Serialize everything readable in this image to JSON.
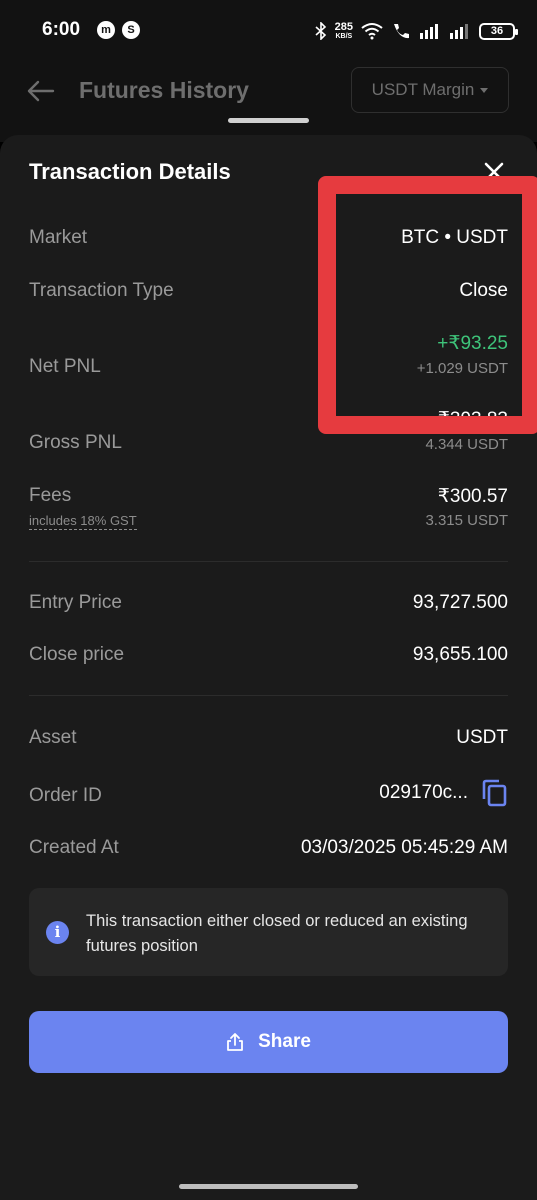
{
  "status_bar": {
    "time": "6:00",
    "net_speed_value": "285",
    "net_speed_unit": "KB/S",
    "battery": "36",
    "icons": [
      "coinmarket-icon",
      "s-app-icon",
      "bluetooth-icon",
      "wifi-icon",
      "call-icon",
      "signal-icon",
      "signal-icon",
      "battery-icon"
    ]
  },
  "header": {
    "title": "Futures History",
    "margin_selector": "USDT Margin"
  },
  "sheet": {
    "title": "Transaction Details",
    "rows": {
      "market": {
        "label": "Market",
        "value": "BTC • USDT"
      },
      "transaction_type": {
        "label": "Transaction Type",
        "value": "Close"
      },
      "net_pnl": {
        "label": "Net PNL",
        "value": "+₹93.25",
        "subvalue": "+1.029 USDT"
      },
      "gross_pnl": {
        "label": "Gross PNL",
        "value": "₹393.83",
        "subvalue": "4.344 USDT"
      },
      "fees": {
        "label": "Fees",
        "note": "includes 18% GST",
        "value": "₹300.57",
        "subvalue": "3.315 USDT"
      },
      "entry_price": {
        "label": "Entry Price",
        "value": "93,727.500"
      },
      "close_price": {
        "label": "Close price",
        "value": "93,655.100"
      },
      "asset": {
        "label": "Asset",
        "value": "USDT"
      },
      "order_id": {
        "label": "Order ID",
        "value": "029170c..."
      },
      "created_at": {
        "label": "Created At",
        "value": "03/03/2025 05:45:29 AM"
      }
    },
    "info": {
      "icon": "i",
      "text": "This transaction either closed or reduced an existing futures position"
    },
    "share_label": "Share"
  },
  "colors": {
    "accent": "#6b84f0",
    "positive": "#3ec47a",
    "highlight": "#e63b3f",
    "sheet_bg": "#1b1b1b"
  }
}
